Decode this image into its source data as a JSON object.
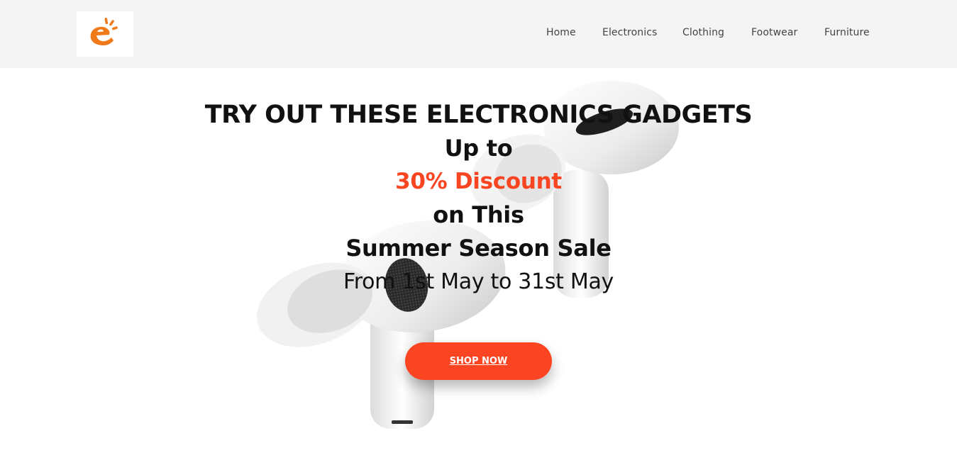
{
  "nav": {
    "logo_alt": "e",
    "links": [
      "Home",
      "Electronics",
      "Clothing",
      "Footwear",
      "Furniture"
    ]
  },
  "hero": {
    "headline": "TRY OUT THESE ELECTRONICS GADGETS",
    "line1": "Up to",
    "line2": "30% Discount",
    "line3": "on This",
    "line4": "Summer Season Sale",
    "line5": "From 1st May to 31st May",
    "cta": "SHOP NOW",
    "product_image": "wireless-earbuds-image"
  },
  "colors": {
    "accent": "#fa4522",
    "logo_orange": "#f07a1a",
    "nav_background": "#f4f4f4",
    "text": "#111111"
  }
}
